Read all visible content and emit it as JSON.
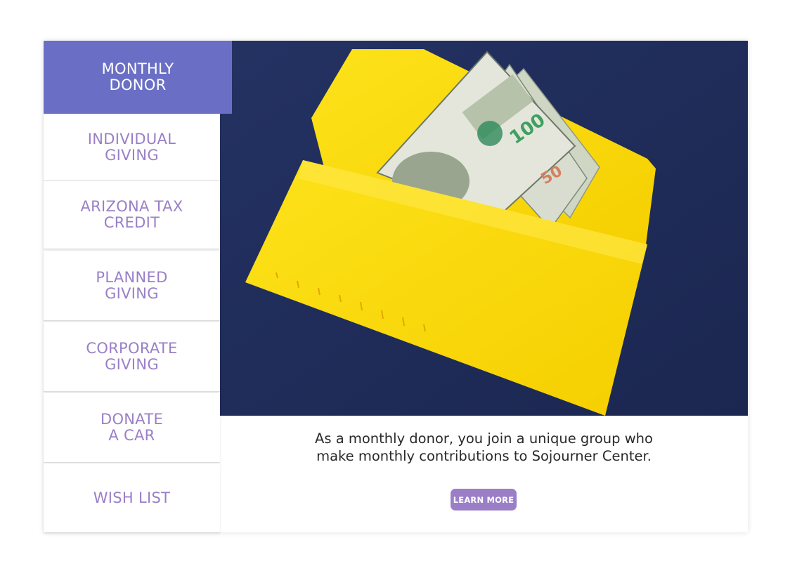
{
  "sidebar": {
    "items": [
      {
        "label": "MONTHLY\nDONOR",
        "active": true
      },
      {
        "label": "INDIVIDUAL\nGIVING",
        "active": false
      },
      {
        "label": "ARIZONA TAX\nCREDIT",
        "active": false
      },
      {
        "label": "PLANNED\nGIVING",
        "active": false
      },
      {
        "label": "CORPORATE\nGIVING",
        "active": false
      },
      {
        "label": "DONATE\nA CAR",
        "active": false
      },
      {
        "label": "WISH LIST",
        "active": false
      }
    ]
  },
  "main": {
    "description": "As a monthly donor, you join a unique group who\nmake monthly contributions to Sojourner Center.",
    "learn_more_label": "LEARN MORE"
  },
  "colors": {
    "accent_active": "#6a6fc5",
    "accent_text": "#9a7fc7",
    "photo_background": "#1f2c57",
    "envelope": "#fcd900"
  }
}
